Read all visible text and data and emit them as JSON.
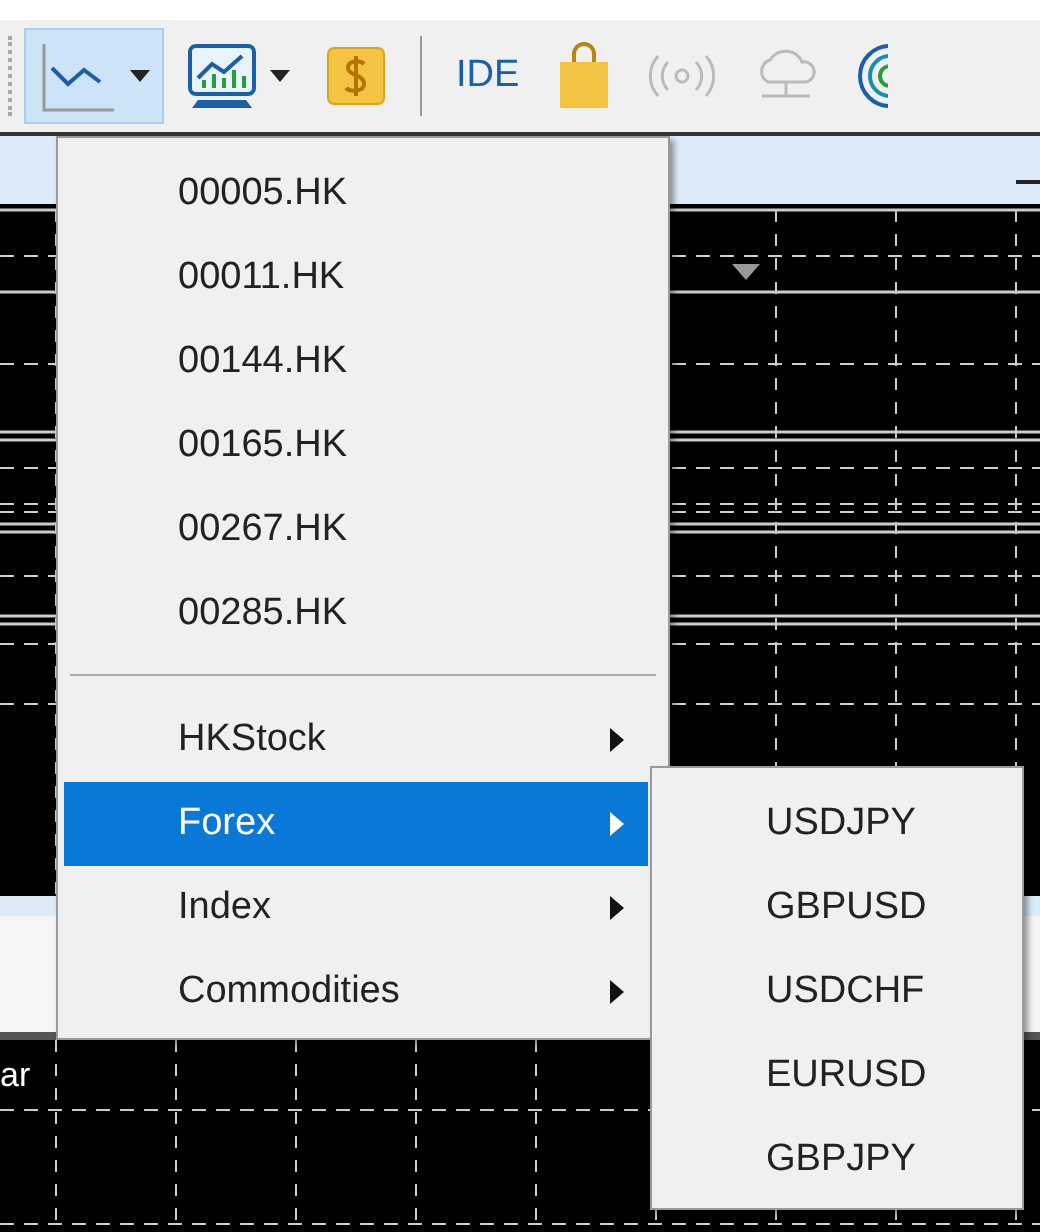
{
  "toolbar": {
    "buttons": [
      {
        "kind": "line-chart",
        "selected": true,
        "disabled": false
      },
      {
        "kind": "monitor-chart",
        "selected": false,
        "disabled": false
      },
      {
        "kind": "dollar",
        "selected": false,
        "disabled": false
      },
      {
        "kind": "text",
        "label": "IDE",
        "selected": false,
        "disabled": false
      },
      {
        "kind": "bag",
        "selected": false,
        "disabled": false
      },
      {
        "kind": "signal",
        "selected": false,
        "disabled": true
      },
      {
        "kind": "cloud",
        "selected": false,
        "disabled": true
      },
      {
        "kind": "target",
        "selected": false,
        "disabled": false
      }
    ]
  },
  "chart_area": {
    "side_label": "ar"
  },
  "menu": {
    "items": [
      {
        "kind": "item",
        "label": "00005.HK"
      },
      {
        "kind": "item",
        "label": "00011.HK"
      },
      {
        "kind": "item",
        "label": "00144.HK"
      },
      {
        "kind": "item",
        "label": "00165.HK"
      },
      {
        "kind": "item",
        "label": "00267.HK"
      },
      {
        "kind": "item",
        "label": "00285.HK"
      },
      {
        "kind": "separator"
      },
      {
        "kind": "submenu",
        "label": "HKStock",
        "selected": false
      },
      {
        "kind": "submenu",
        "label": "Forex",
        "selected": true
      },
      {
        "kind": "submenu",
        "label": "Index",
        "selected": false
      },
      {
        "kind": "submenu",
        "label": "Commodities",
        "selected": false
      }
    ]
  },
  "submenu": {
    "items": [
      "USDJPY",
      "GBPUSD",
      "USDCHF",
      "EURUSD",
      "GBPJPY"
    ]
  }
}
